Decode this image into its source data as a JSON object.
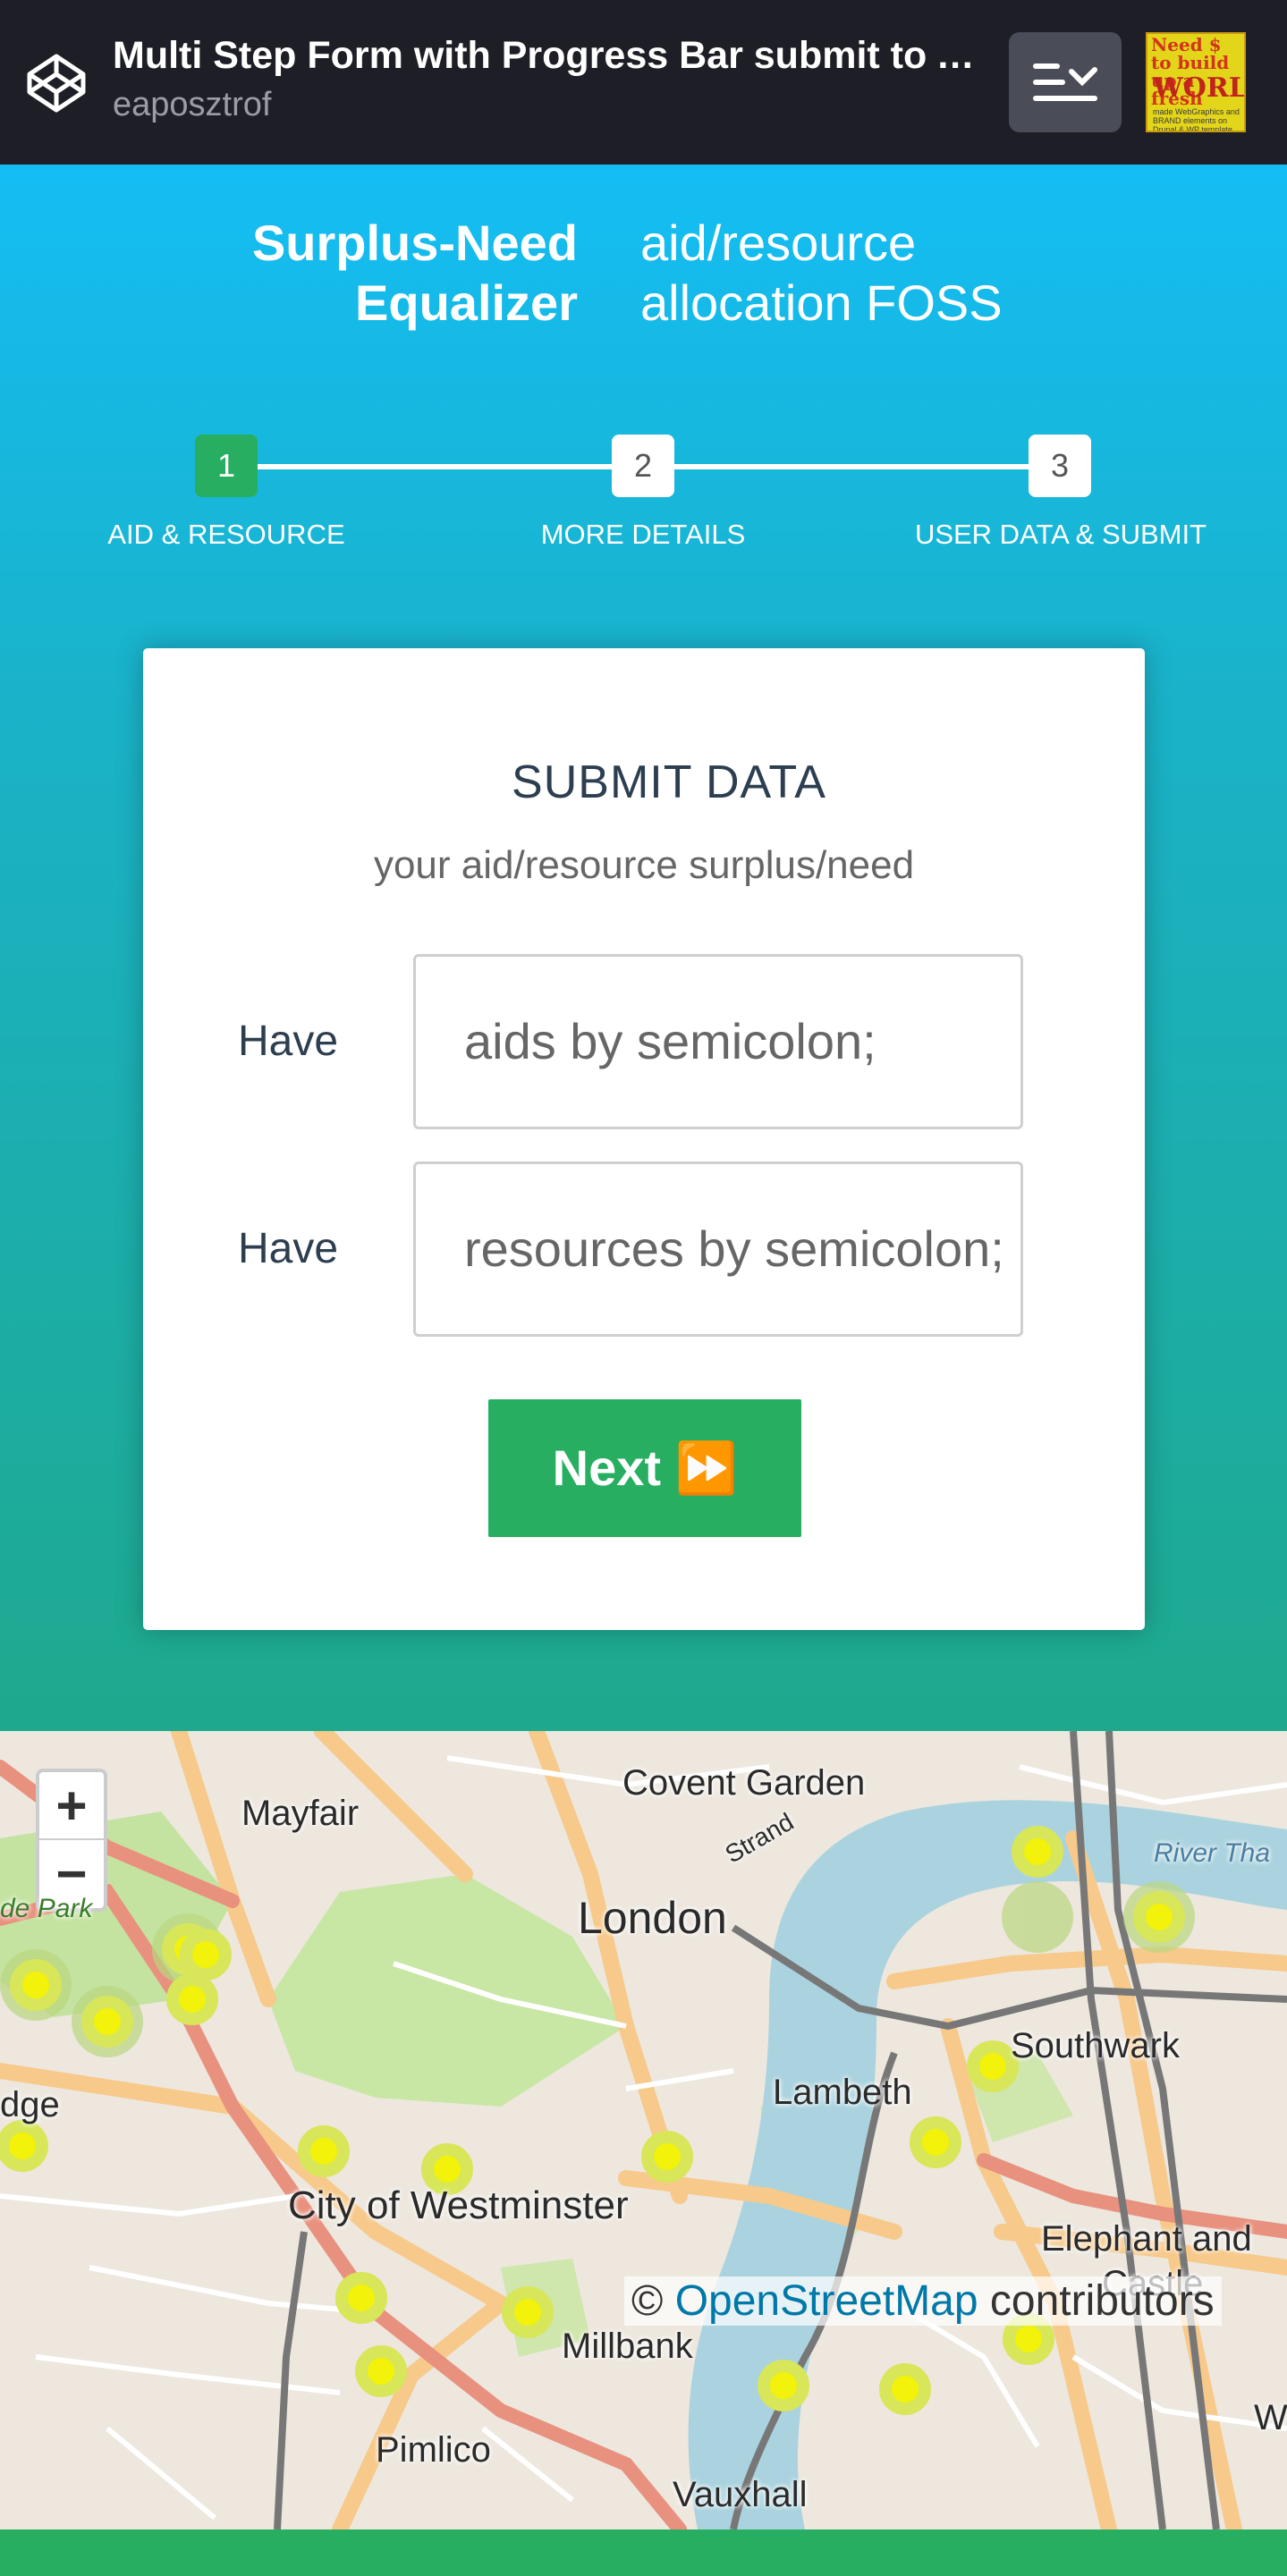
{
  "topbar": {
    "title": "Multi Step Form with Progress Bar submit to A...",
    "author": "eaposztrof",
    "thumbnail": {
      "line1": "Need $ to build up a fresh",
      "line2": "WORLD",
      "line3": "made WebGraphics and BRAND elements on Drupal & WP template"
    }
  },
  "header": {
    "brand": [
      "Surplus-Need",
      "Equalizer"
    ],
    "tagline": [
      "aid/resource",
      "allocation FOSS"
    ]
  },
  "steps": [
    {
      "number": "1",
      "label": "AID & RESOURCE",
      "active": true
    },
    {
      "number": "2",
      "label": "MORE DETAILS",
      "active": false
    },
    {
      "number": "3",
      "label": "USER DATA & SUBMIT",
      "active": false
    }
  ],
  "form": {
    "title": "SUBMIT DATA",
    "subtitle": "your aid/resource surplus/need",
    "fields": [
      {
        "label": "Have",
        "placeholder": "aids by semicolon;"
      },
      {
        "label": "Have",
        "placeholder": "resources by semicolon;"
      }
    ],
    "next_label": "Next ⏩"
  },
  "map": {
    "zoom_in": "+",
    "zoom_out": "−",
    "labels": [
      "Covent Garden",
      "Mayfair",
      "Strand",
      "London",
      "River Tha",
      "de Park",
      "Southwark",
      "Lambeth",
      "dge",
      "City of Westminster",
      "Elephant and",
      "Castle",
      "Millbank",
      "Pimlico",
      "Vauxhall",
      "W"
    ],
    "attribution_prefix": "© ",
    "attribution_link": "OpenStreetMap",
    "attribution_suffix": " contributors"
  },
  "colors": {
    "accent": "#27ae60",
    "topbar": "#1e1f26",
    "hero_top": "#14bdf4",
    "hero_bottom": "#1ea98d",
    "marker": "#f2f20a"
  }
}
